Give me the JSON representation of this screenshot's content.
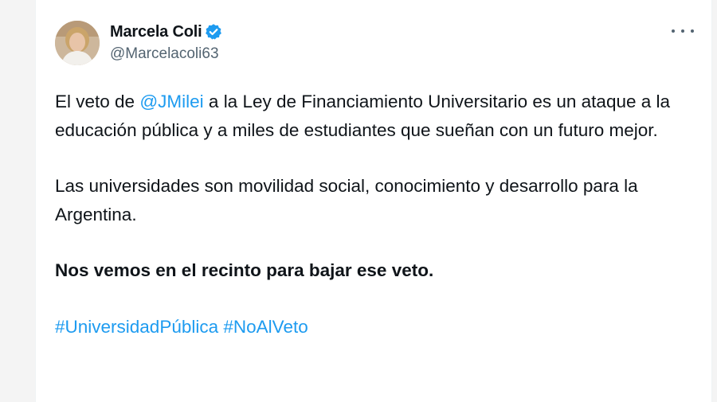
{
  "tweet": {
    "author": {
      "display_name": "Marcela Coli",
      "handle": "@Marcelacoli63",
      "verified_icon": "verified-badge-icon",
      "avatar_icon": "profile-avatar"
    },
    "more_icon": "more-options-icon",
    "colors": {
      "link": "#1d9bf0",
      "text": "#0f1419",
      "muted": "#536471"
    },
    "body": {
      "p1_before": "El veto de ",
      "p1_mention": "@JMilei",
      "p1_after": " a la Ley de Financiamiento Universitario es un ataque a la educación pública y a miles de estudiantes que sueñan con un futuro mejor.",
      "p2": "Las universidades son movilidad social, conocimiento y desarrollo para la Argentina.",
      "p3": "Nos vemos en el recinto para bajar ese veto.",
      "hashtag_1": "#UniversidadPública",
      "hashtag_2": "#NoAlVeto"
    }
  }
}
